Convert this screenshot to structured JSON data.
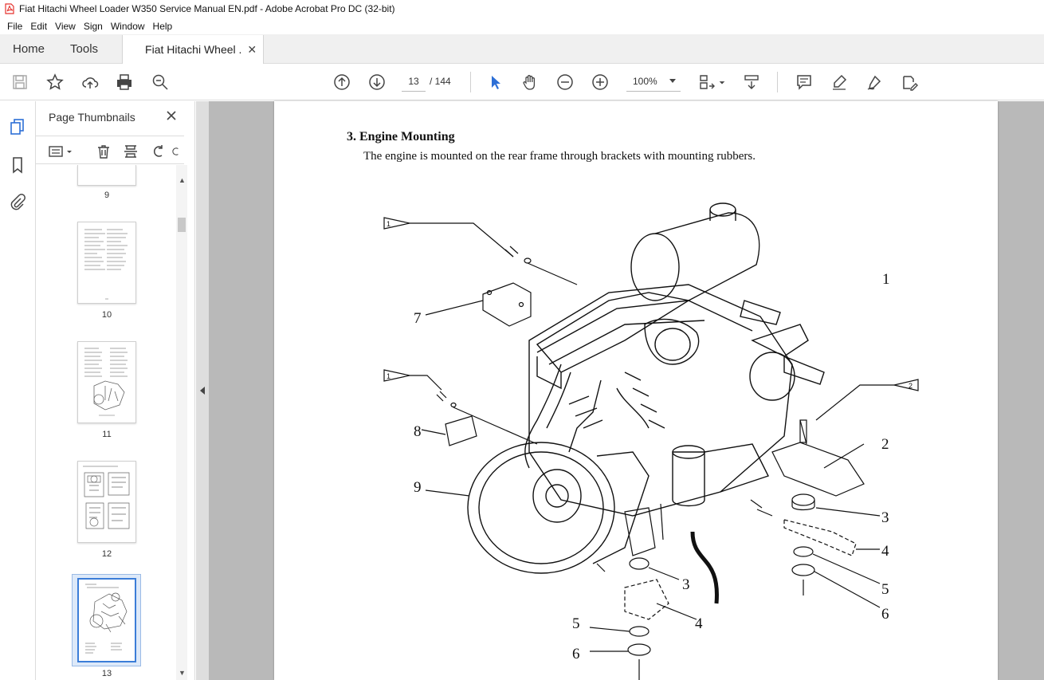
{
  "window": {
    "title": "Fiat Hitachi Wheel Loader W350 Service Manual EN.pdf - Adobe Acrobat Pro DC (32-bit)"
  },
  "menu": [
    "File",
    "Edit",
    "View",
    "Sign",
    "Window",
    "Help"
  ],
  "tabs": {
    "home": "Home",
    "tools": "Tools",
    "document": "Fiat Hitachi Wheel ..."
  },
  "toolbar": {
    "current_page": "13",
    "total_pages": "/ 144",
    "zoom": "100%"
  },
  "panel": {
    "title": "Page Thumbnails",
    "thumbnails": [
      {
        "label": "9"
      },
      {
        "label": "10"
      },
      {
        "label": "11"
      },
      {
        "label": "12"
      },
      {
        "label": "13",
        "selected": true
      }
    ]
  },
  "document": {
    "heading": "3.  Engine Mounting",
    "body": "The engine is mounted on the rear frame through brackets with mounting rubbers.",
    "callouts": [
      "1",
      "2",
      "3",
      "4",
      "5",
      "6",
      "7",
      "8",
      "9",
      "3",
      "4",
      "5",
      "6"
    ],
    "flags": [
      "1",
      "1",
      "2"
    ]
  },
  "colors": {
    "accent": "#3b7dd8",
    "acrobat_red": "#e5322d",
    "viewer_bg": "#b9b9b9"
  }
}
